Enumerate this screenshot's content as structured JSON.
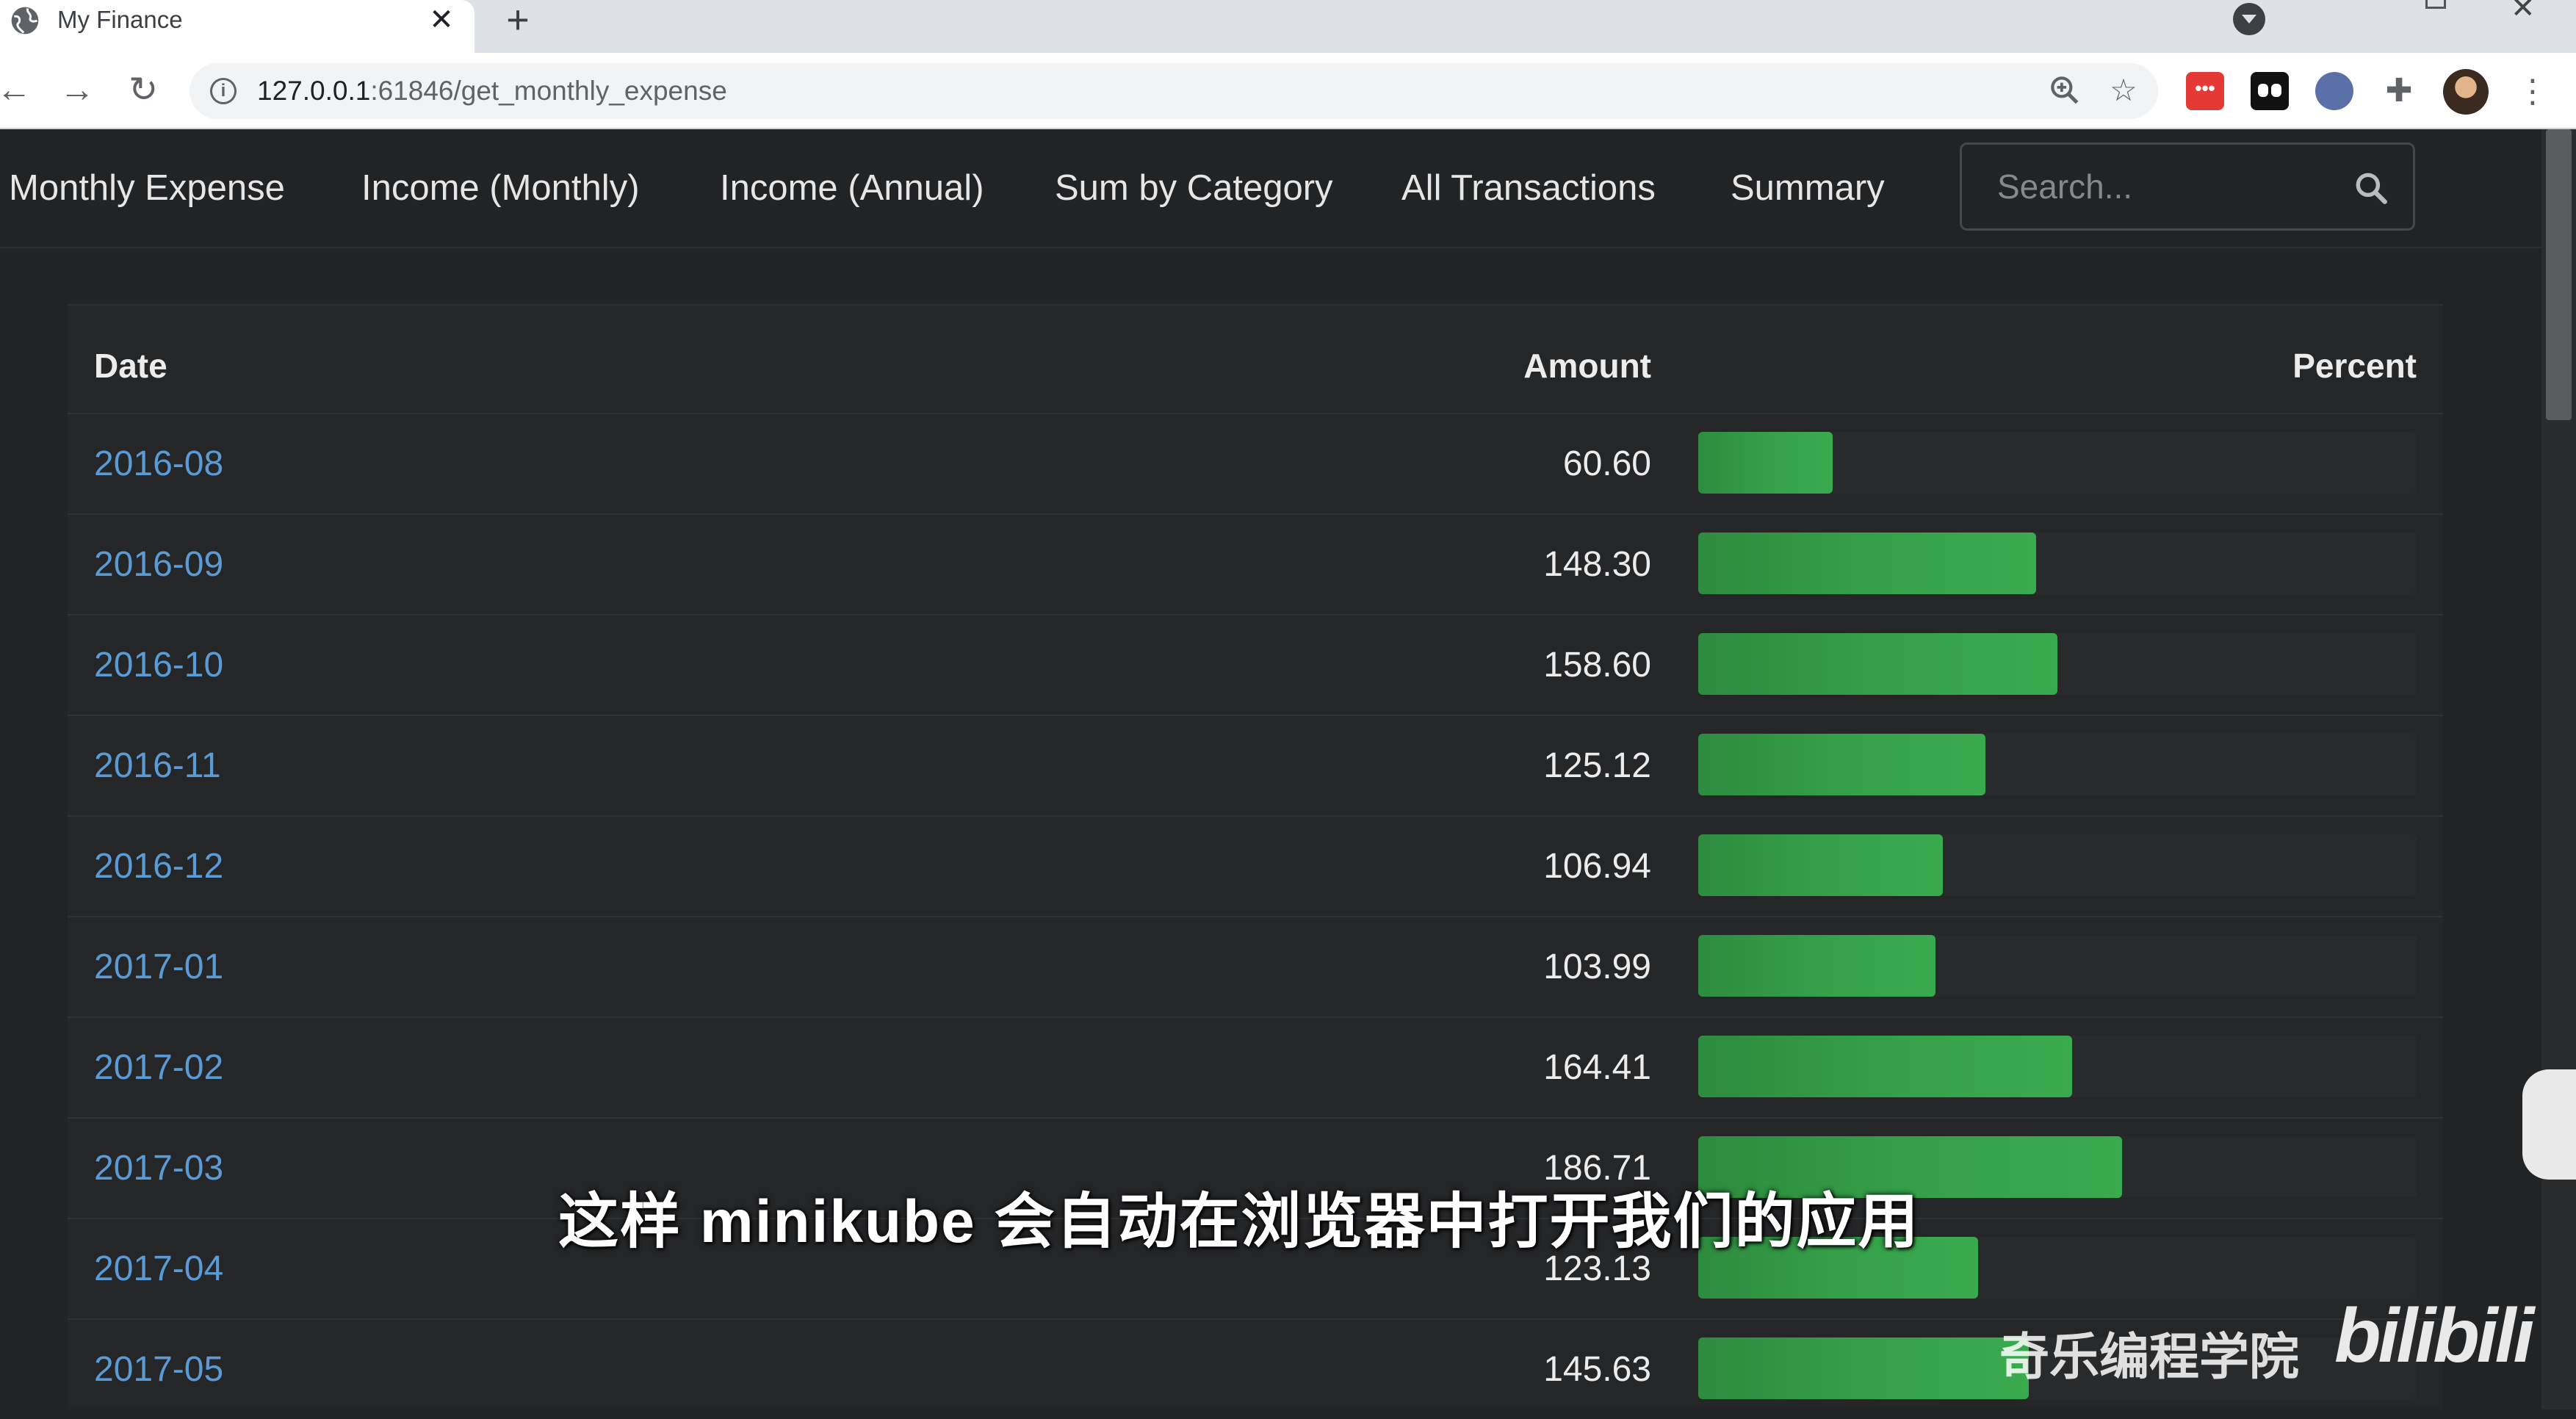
{
  "browser": {
    "tab_title": "My Finance",
    "tab_close": "✕",
    "new_tab": "+",
    "url_host": "127.0.0.1",
    "url_rest": ":61846/get_monthly_expense",
    "ext_red_label": "•••"
  },
  "nav": {
    "items": [
      {
        "label": "Monthly Expense"
      },
      {
        "label": "Income (Monthly)"
      },
      {
        "label": "Income (Annual)"
      },
      {
        "label": "Sum by Category"
      },
      {
        "label": "All Transactions"
      },
      {
        "label": "Summary"
      }
    ],
    "search_placeholder": "Search..."
  },
  "table": {
    "headers": {
      "date": "Date",
      "amount": "Amount",
      "percent": "Percent"
    },
    "rows": [
      {
        "date": "2016-08",
        "amount": "60.60",
        "percent": 0.187
      },
      {
        "date": "2016-09",
        "amount": "148.30",
        "percent": 0.47
      },
      {
        "date": "2016-10",
        "amount": "158.60",
        "percent": 0.5
      },
      {
        "date": "2016-11",
        "amount": "125.12",
        "percent": 0.4
      },
      {
        "date": "2016-12",
        "amount": "106.94",
        "percent": 0.341
      },
      {
        "date": "2017-01",
        "amount": "103.99",
        "percent": 0.33
      },
      {
        "date": "2017-02",
        "amount": "164.41",
        "percent": 0.52
      },
      {
        "date": "2017-03",
        "amount": "186.71",
        "percent": 0.59
      },
      {
        "date": "2017-04",
        "amount": "123.13",
        "percent": 0.39
      },
      {
        "date": "2017-05",
        "amount": "145.63",
        "percent": 0.46
      }
    ]
  },
  "overlay": {
    "subtitle": "这样 minikube 会自动在浏览器中打开我们的应用",
    "watermark_text": "奇乐编程学院",
    "watermark_logo": "bilibili"
  },
  "colors": {
    "page_bg": "#222325",
    "link": "#5b9bd5",
    "bar_green": "#35a14a"
  }
}
